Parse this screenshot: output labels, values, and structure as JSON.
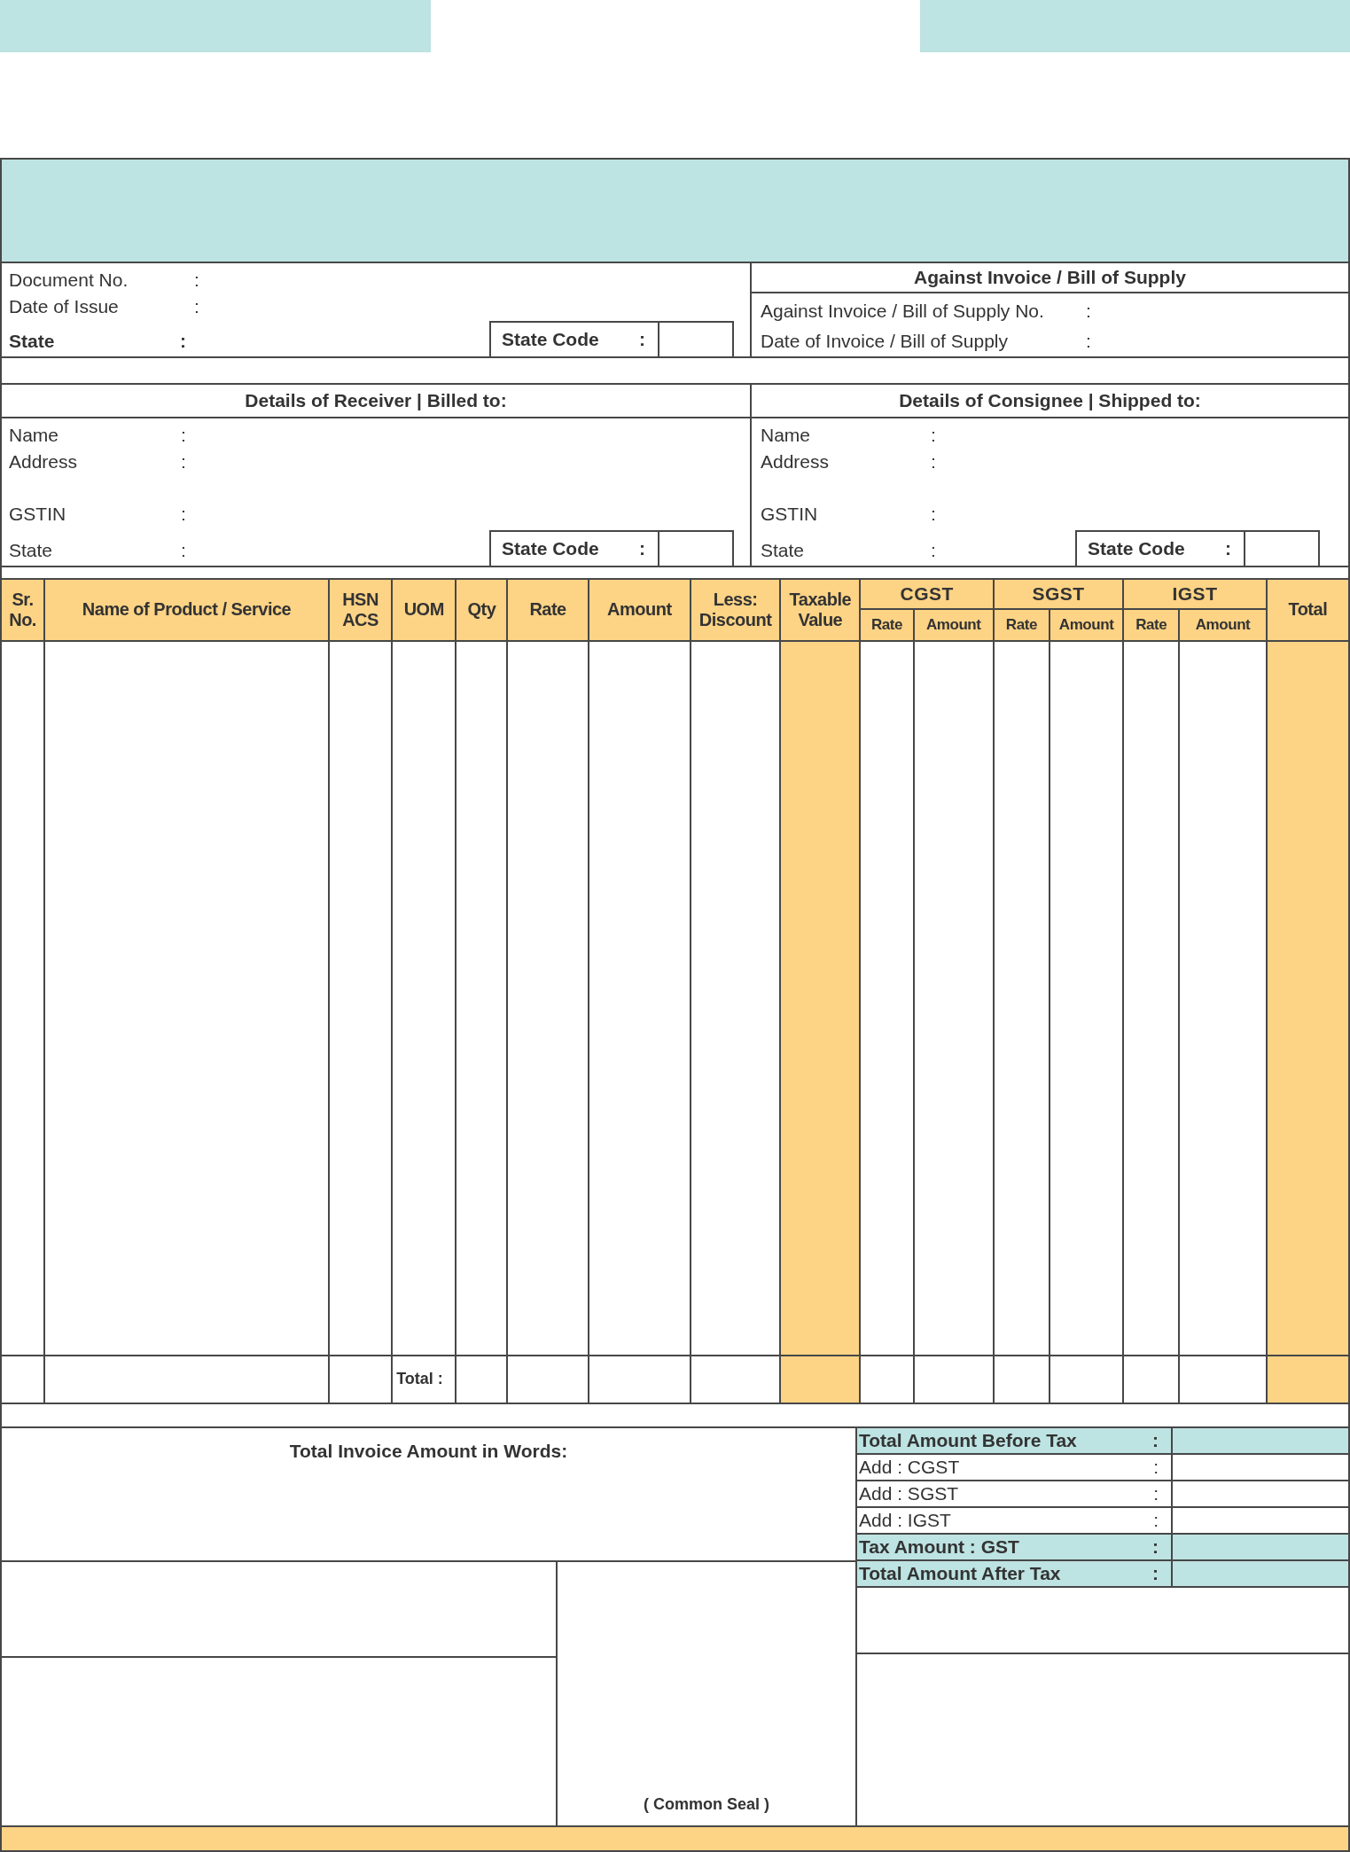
{
  "document_info": {
    "fields": [
      {
        "label": "Document No.",
        "separator": ":",
        "bold": false
      },
      {
        "label": "Date of Issue",
        "separator": ":",
        "bold": false
      },
      {
        "label": "State",
        "separator": ":",
        "bold": true
      }
    ],
    "state_code": {
      "label": "State Code",
      "separator": ":"
    }
  },
  "against_invoice": {
    "title": "Against Invoice / Bill of Supply",
    "fields": [
      {
        "label": "Against Invoice / Bill of Supply No.",
        "separator": ":"
      },
      {
        "label": "Date of Invoice / Bill of Supply",
        "separator": ":"
      }
    ]
  },
  "receiver": {
    "title": "Details of Receiver | Billed to:",
    "fields": [
      {
        "label": "Name",
        "separator": ":"
      },
      {
        "label": "Address",
        "separator": ":"
      },
      {
        "label": "GSTIN",
        "separator": ":"
      },
      {
        "label": "State",
        "separator": ":"
      }
    ],
    "state_code": {
      "label": "State Code",
      "separator": ":"
    }
  },
  "consignee": {
    "title": "Details of Consignee | Shipped to:",
    "fields": [
      {
        "label": "Name",
        "separator": ":"
      },
      {
        "label": "Address",
        "separator": ":"
      },
      {
        "label": "GSTIN",
        "separator": ":"
      },
      {
        "label": "State",
        "separator": ":"
      }
    ],
    "state_code": {
      "label": "State Code",
      "separator": ":"
    }
  },
  "items_table": {
    "columns": [
      {
        "kind": "single",
        "label": "Sr.\nNo.",
        "highlighted": false
      },
      {
        "kind": "single",
        "label": "Name of Product / Service",
        "highlighted": false
      },
      {
        "kind": "single",
        "label": "HSN\nACS",
        "highlighted": false
      },
      {
        "kind": "single",
        "label": "UOM",
        "highlighted": false
      },
      {
        "kind": "single",
        "label": "Qty",
        "highlighted": false
      },
      {
        "kind": "single",
        "label": "Rate",
        "highlighted": false
      },
      {
        "kind": "single",
        "label": "Amount",
        "highlighted": false
      },
      {
        "kind": "single",
        "label": "Less:\nDiscount",
        "highlighted": false
      },
      {
        "kind": "single",
        "label": "Taxable\nValue",
        "highlighted": true
      },
      {
        "kind": "group",
        "label": "CGST",
        "subcolumns": [
          "Rate",
          "Amount"
        ]
      },
      {
        "kind": "group",
        "label": "SGST",
        "subcolumns": [
          "Rate",
          "Amount"
        ]
      },
      {
        "kind": "group",
        "label": "IGST",
        "subcolumns": [
          "Rate",
          "Amount"
        ]
      },
      {
        "kind": "single",
        "label": "Total",
        "highlighted": true
      }
    ],
    "total_label": "Total :"
  },
  "amount_in_words": {
    "label": "Total Invoice Amount in Words:"
  },
  "summary": [
    {
      "label": "Total Amount Before Tax",
      "separator": ":",
      "highlighted": true
    },
    {
      "label": "Add : CGST",
      "separator": ":",
      "highlighted": false
    },
    {
      "label": "Add : SGST",
      "separator": ":",
      "highlighted": false
    },
    {
      "label": "Add : IGST",
      "separator": ":",
      "highlighted": false
    },
    {
      "label": "Tax Amount : GST",
      "separator": ":",
      "highlighted": true
    },
    {
      "label": "Total Amount After Tax",
      "separator": ":",
      "highlighted": true
    }
  ],
  "common_seal": "( Common Seal )"
}
